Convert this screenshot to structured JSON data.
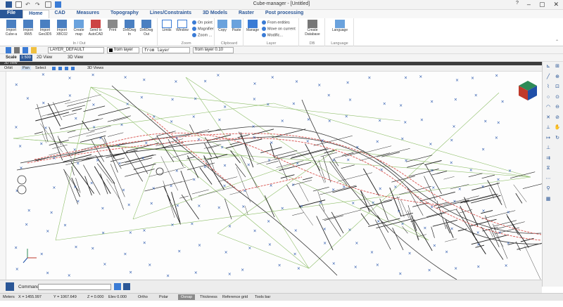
{
  "window": {
    "title": "Cube-manager - [Untitled]"
  },
  "menu": {
    "file": "File",
    "tabs": [
      "Home",
      "CAD",
      "Measures",
      "Topography",
      "Lines/Constraints",
      "3D Models",
      "Raster",
      "Post processing"
    ]
  },
  "ribbon": {
    "io_group": {
      "label": "In / Out",
      "buttons": [
        "Import Cube-a",
        "Import RW5",
        "Import Geo3D5",
        "Import XBC02",
        "Create map",
        "Send to AutoCAD",
        "Print",
        "Dxf/Dwg In",
        "Dxf/Dwg Out"
      ]
    },
    "zoom_group": {
      "label": "Zoom",
      "buttons": [
        "Limits",
        "Window"
      ],
      "small": [
        "On point",
        "Magnifier",
        "Zoom ..."
      ]
    },
    "clipboard_group": {
      "label": "Clipboard",
      "buttons": [
        "Copy",
        "Paste"
      ]
    },
    "layer_group": {
      "label": "Layer",
      "buttons": [
        "Manage"
      ],
      "small": [
        "From entities",
        "Move on current",
        "Modific..."
      ]
    },
    "db_group": {
      "label": "DB",
      "buttons": [
        "Create Database"
      ]
    },
    "language_group": {
      "label": "Language",
      "buttons": [
        "Language"
      ]
    }
  },
  "properties": {
    "layer": "LAYER_DEFAULT",
    "color": "from layer",
    "linetype": "from layer",
    "lineweight": "from layer  0.10"
  },
  "scalebar": {
    "label": "Scale",
    "value": "1:500",
    "view2d": "2D View",
    "view3d": "3D View"
  },
  "viewport": {
    "title": "3D View",
    "tools": [
      "Orbit",
      "Pan",
      "Select",
      "3D Views"
    ]
  },
  "command": {
    "label": "Command"
  },
  "status": {
    "units": "Meters",
    "x": "X = 1455.997",
    "y": "Y = 1067.649",
    "z": "Z = 0.000",
    "elev": "Elev 0.000",
    "ortho": "Ortho",
    "polar": "Polar",
    "osnap": "Osnap",
    "thickness": "Thickness",
    "refgrid": "Reference grid",
    "toolsbar": "Tools bar"
  },
  "colors": {
    "accent": "#2b5797",
    "survey_red": "#d9534f",
    "green_lines": "#8fbf6a",
    "blue_marks": "#1f4fa8",
    "viewcube_red": "#c0392b",
    "viewcube_green": "#2e8b57"
  }
}
